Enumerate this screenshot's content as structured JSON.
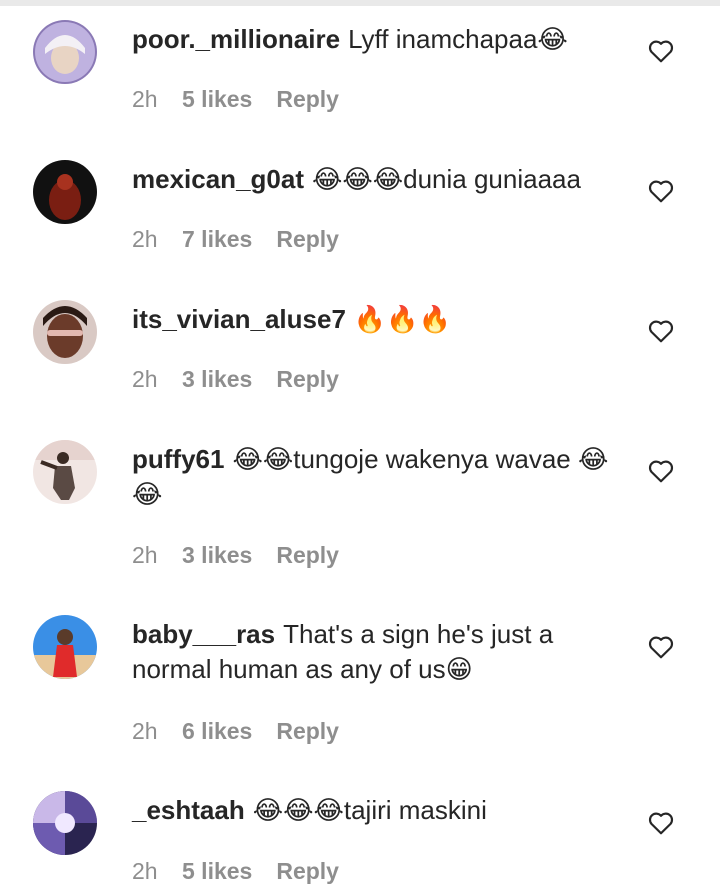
{
  "comments": [
    {
      "username": "poor._millionaire",
      "text": "Lyff inamchapaa😂",
      "time": "2h",
      "likes": "5 likes",
      "reply": "Reply"
    },
    {
      "username": "mexican_g0at",
      "text": "😂😂😂dunia guniaaaa",
      "time": "2h",
      "likes": "7 likes",
      "reply": "Reply"
    },
    {
      "username": "its_vivian_aluse7",
      "text": "🔥🔥🔥",
      "time": "2h",
      "likes": "3 likes",
      "reply": "Reply"
    },
    {
      "username": "puffy61",
      "text": "😂😂tungoje wakenya wavae 😂😂",
      "time": "2h",
      "likes": "3 likes",
      "reply": "Reply"
    },
    {
      "username": "baby___ras",
      "text": "That's a sign he's just a normal human as any of us😁",
      "time": "2h",
      "likes": "6 likes",
      "reply": "Reply"
    },
    {
      "username": "_eshtaah",
      "text": "😂😂😂tajiri maskini",
      "time": "2h",
      "likes": "5 likes",
      "reply": "Reply"
    }
  ],
  "colors": {
    "username": "#262626",
    "text": "#262626",
    "meta": "#8e8e8e",
    "heart": "#262626"
  },
  "icons": {
    "like": "heart-outline-icon",
    "avatar": "profile-avatar"
  }
}
